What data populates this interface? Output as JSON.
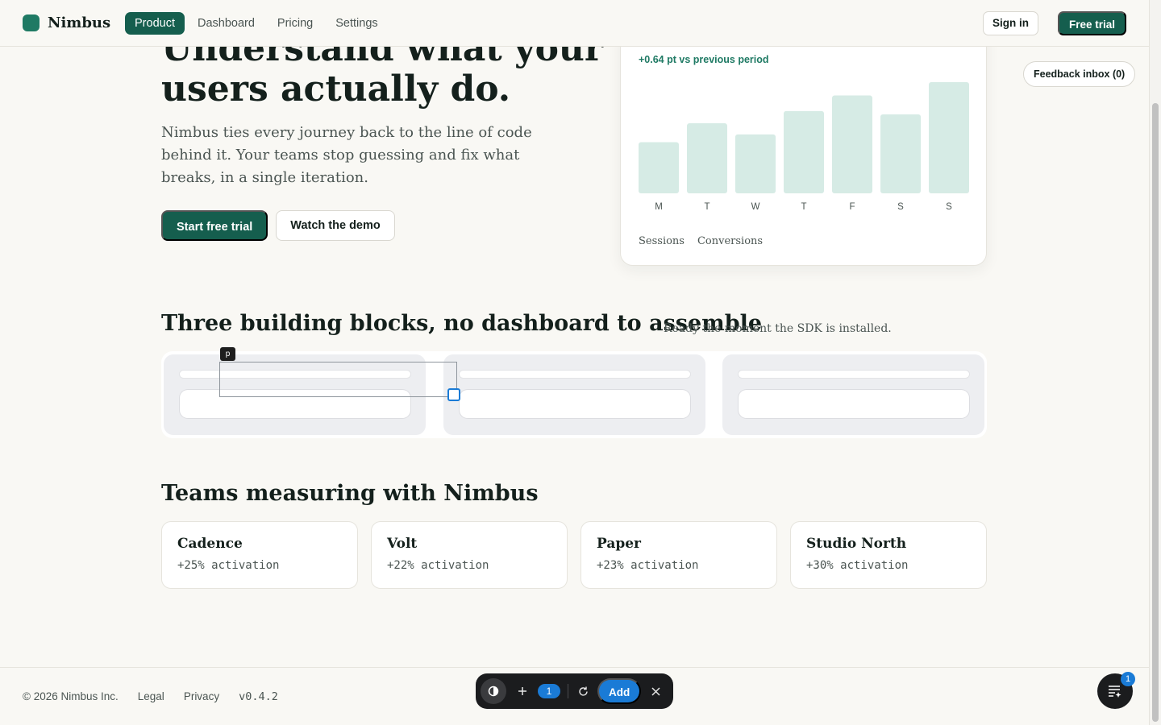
{
  "nav": {
    "brand": "Nimbus",
    "links": [
      "Product",
      "Dashboard",
      "Pricing",
      "Settings"
    ],
    "active": "Product",
    "sign_in": "Sign in",
    "free_trial": "Free trial"
  },
  "hero": {
    "title": "Understand what your users actually do.",
    "body": "Nimbus ties every journey back to the line of code behind it. Your teams stop guessing and fix what breaks, in a single iteration.",
    "primary_cta": "Start free trial",
    "secondary_cta": "Watch the demo"
  },
  "chart_card": {
    "delta": "+0.64 pt vs previous period",
    "legend": [
      "Sessions",
      "Conversions"
    ]
  },
  "chart_data": {
    "type": "bar",
    "categories": [
      "M",
      "T",
      "W",
      "T",
      "F",
      "S",
      "S"
    ],
    "values": [
      46,
      63,
      53,
      74,
      88,
      71,
      100
    ],
    "ylim": [
      0,
      100
    ],
    "grid": false,
    "bar_color": "#d6ebe5"
  },
  "feedback": {
    "label": "Feedback inbox (0)"
  },
  "blocks": {
    "title": "Three building blocks, no dashboard to assemble",
    "subtitle": "Ready the moment the SDK is installed.",
    "selection_tag": "p"
  },
  "teams": {
    "title": "Teams measuring with Nimbus",
    "items": [
      {
        "name": "Cadence",
        "stat": "+25% activation"
      },
      {
        "name": "Volt",
        "stat": "+22% activation"
      },
      {
        "name": "Paper",
        "stat": "+23% activation"
      },
      {
        "name": "Studio North",
        "stat": "+30% activation"
      }
    ]
  },
  "footer": {
    "copyright": "© 2026 Nimbus Inc.",
    "legal": "Legal",
    "privacy": "Privacy",
    "version": "v0.4.2"
  },
  "toolbar": {
    "count": "1",
    "add": "Add"
  },
  "fab": {
    "badge": "1"
  },
  "colors": {
    "brand": "#155e4e",
    "accent_blue": "#1a7bd6",
    "background": "#f9f8f4"
  }
}
